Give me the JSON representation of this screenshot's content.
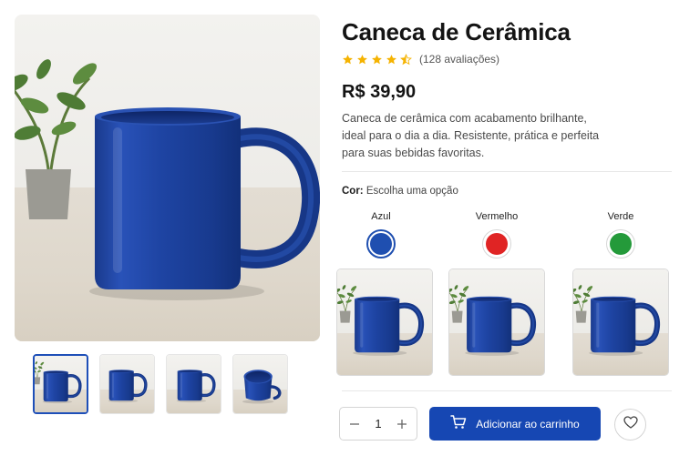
{
  "product": {
    "title": "Caneca de Cerâmica",
    "rating_value": 4.5,
    "rating_max": 5,
    "rating_count_text": "(128 avaliações)",
    "price": "R$ 39,90",
    "description": "Caneca de cerâmica com acabamento brilhante, ideal para o dia a dia. Resistente, prática e perfeita para suas bebidas favoritas."
  },
  "gallery": {
    "thumbnail_count": 4,
    "active_index": 0
  },
  "color_picker": {
    "label_bold": "Cor:",
    "label_hint": "Escolha uma opção",
    "options": [
      {
        "name": "Azul",
        "hex": "#1f4fb0",
        "selected": true
      },
      {
        "name": "Vermelho",
        "hex": "#e02424",
        "selected": false
      },
      {
        "name": "Verde",
        "hex": "#249a3a",
        "selected": false
      }
    ]
  },
  "purchase": {
    "quantity": "1",
    "add_to_cart_label": "Adicionar ao carrinho",
    "decrement_icon": "minus-icon",
    "increment_icon": "plus-icon",
    "cart_icon": "cart-icon",
    "wishlist_icon": "heart-icon"
  },
  "colors": {
    "mug_blue": "#1c3f95",
    "accent": "#1647b3",
    "star": "#f5b301"
  }
}
